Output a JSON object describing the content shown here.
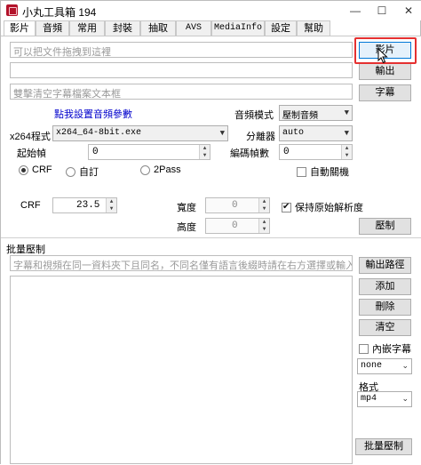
{
  "window": {
    "title": "小丸工具箱 194",
    "minimize": "—",
    "maximize": "☐",
    "close": "✕"
  },
  "tabs": [
    {
      "label": "影片",
      "active": true
    },
    {
      "label": "音頻"
    },
    {
      "label": "常用"
    },
    {
      "label": "封裝"
    },
    {
      "label": "抽取"
    },
    {
      "label": "AVS"
    },
    {
      "label": "MediaInfo"
    },
    {
      "label": "設定"
    },
    {
      "label": "幫助"
    }
  ],
  "video": {
    "video_input_placeholder": "可以把文件拖拽到這裡",
    "video_button": "影片",
    "output_value": "",
    "output_button": "輸出",
    "subtitle_placeholder": "雙擊清空字幕檔案文本框",
    "subtitle_button": "字幕",
    "audio_settings_link": "點我設置音頻參數",
    "audio_mode_label": "音頻模式",
    "audio_mode_value": "壓制音頻",
    "x264_label": "x264程式",
    "x264_value": "x264_64-8bit.exe",
    "splitter_label": "分離器",
    "splitter_value": "auto",
    "start_frame_label": "起始幀",
    "start_frame_value": "0",
    "encode_frames_label": "編碼幀數",
    "encode_frames_value": "0",
    "mode_crf": "CRF",
    "mode_custom": "自訂",
    "mode_2pass": "2Pass",
    "auto_shutdown": "自動關機",
    "crf_label": "CRF",
    "crf_value": "23.5",
    "width_label": "寬度",
    "width_value": "0",
    "height_label": "高度",
    "height_value": "0",
    "keep_resolution": "保持原始解析度",
    "compress_button": "壓制"
  },
  "batch": {
    "title": "批量壓制",
    "hint_placeholder": "字幕和視頻在同一資料夾下且同名，不同名僅有語言後綴時請在右方選擇或輸入",
    "output_path_button": "輸出路徑",
    "add_button": "添加",
    "delete_button": "刪除",
    "clear_button": "清空",
    "embed_subtitle": "內嵌字幕",
    "subtitle_lang_value": "none",
    "format_label": "格式",
    "format_value": "mp4",
    "batch_compress_button": "批量壓制"
  },
  "colors": {
    "highlight": "#e53030",
    "link": "#0000cc",
    "focus": "#0078d7"
  }
}
